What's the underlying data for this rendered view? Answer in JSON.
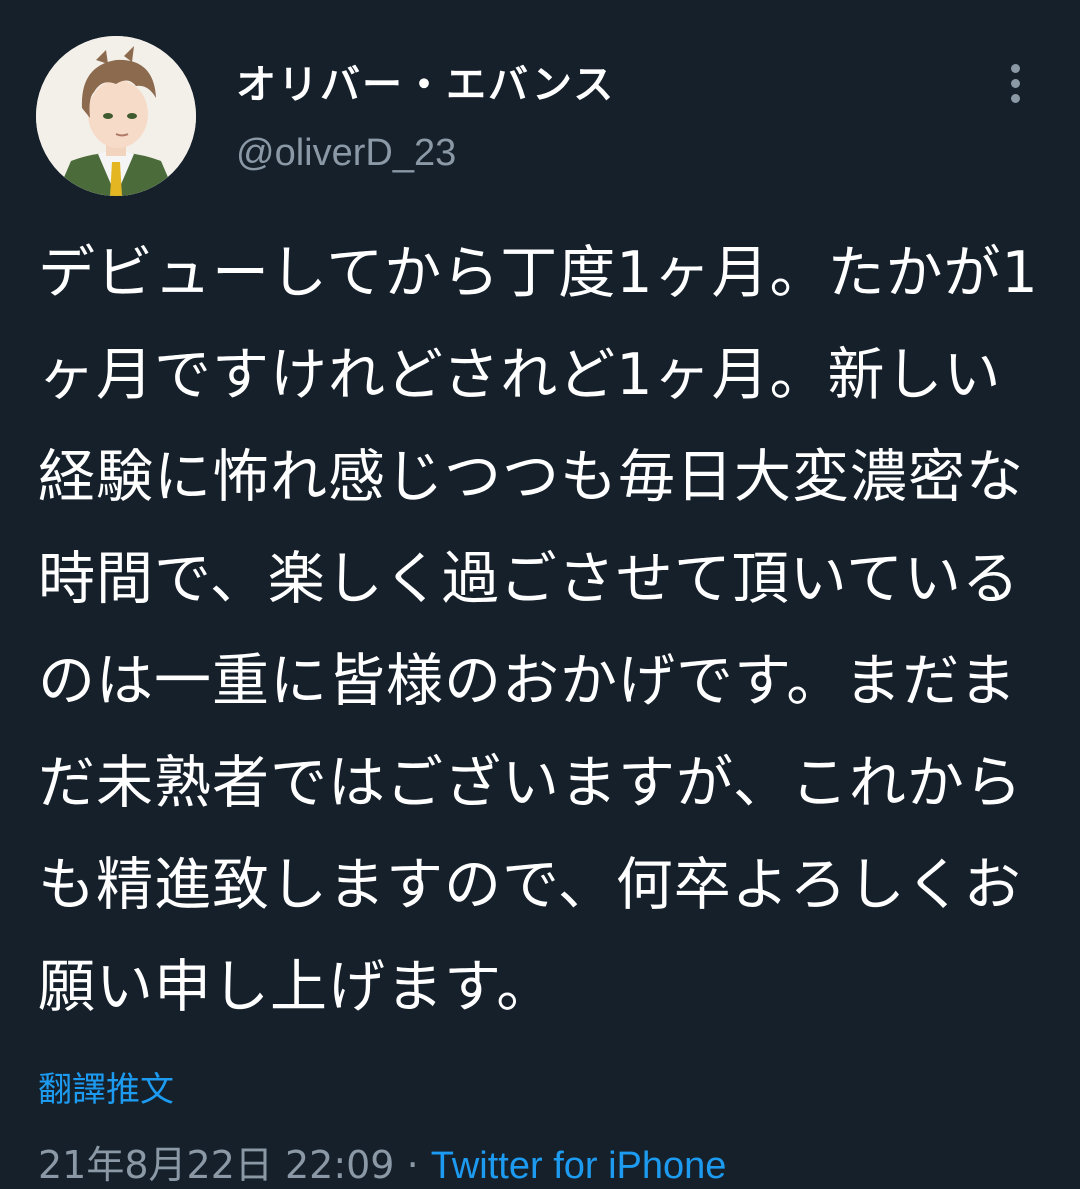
{
  "tweet": {
    "display_name": "オリバー・エバンス",
    "handle": "@oliverD_23",
    "text": "デビューしてから丁度1ヶ月。たかが1ヶ月ですけれどされど1ヶ月。新しい経験に怖れ感じつつも毎日大変濃密な時間で、楽しく過ごさせて頂いているのは一重に皆様のおかげです。まだまだ未熟者ではございますが、これからも精進致しますので、何卒よろしくお願い申し上げます。",
    "translate_label": "翻譯推文",
    "timestamp": "21年8月22日 22:09",
    "separator": " · ",
    "source": "Twitter for iPhone"
  },
  "icons": {
    "more": "more-vertical-icon",
    "avatar": "avatar-image"
  },
  "colors": {
    "background": "#15202b",
    "text": "#ffffff",
    "secondary": "#8b98a5",
    "accent": "#1d9bf0"
  }
}
